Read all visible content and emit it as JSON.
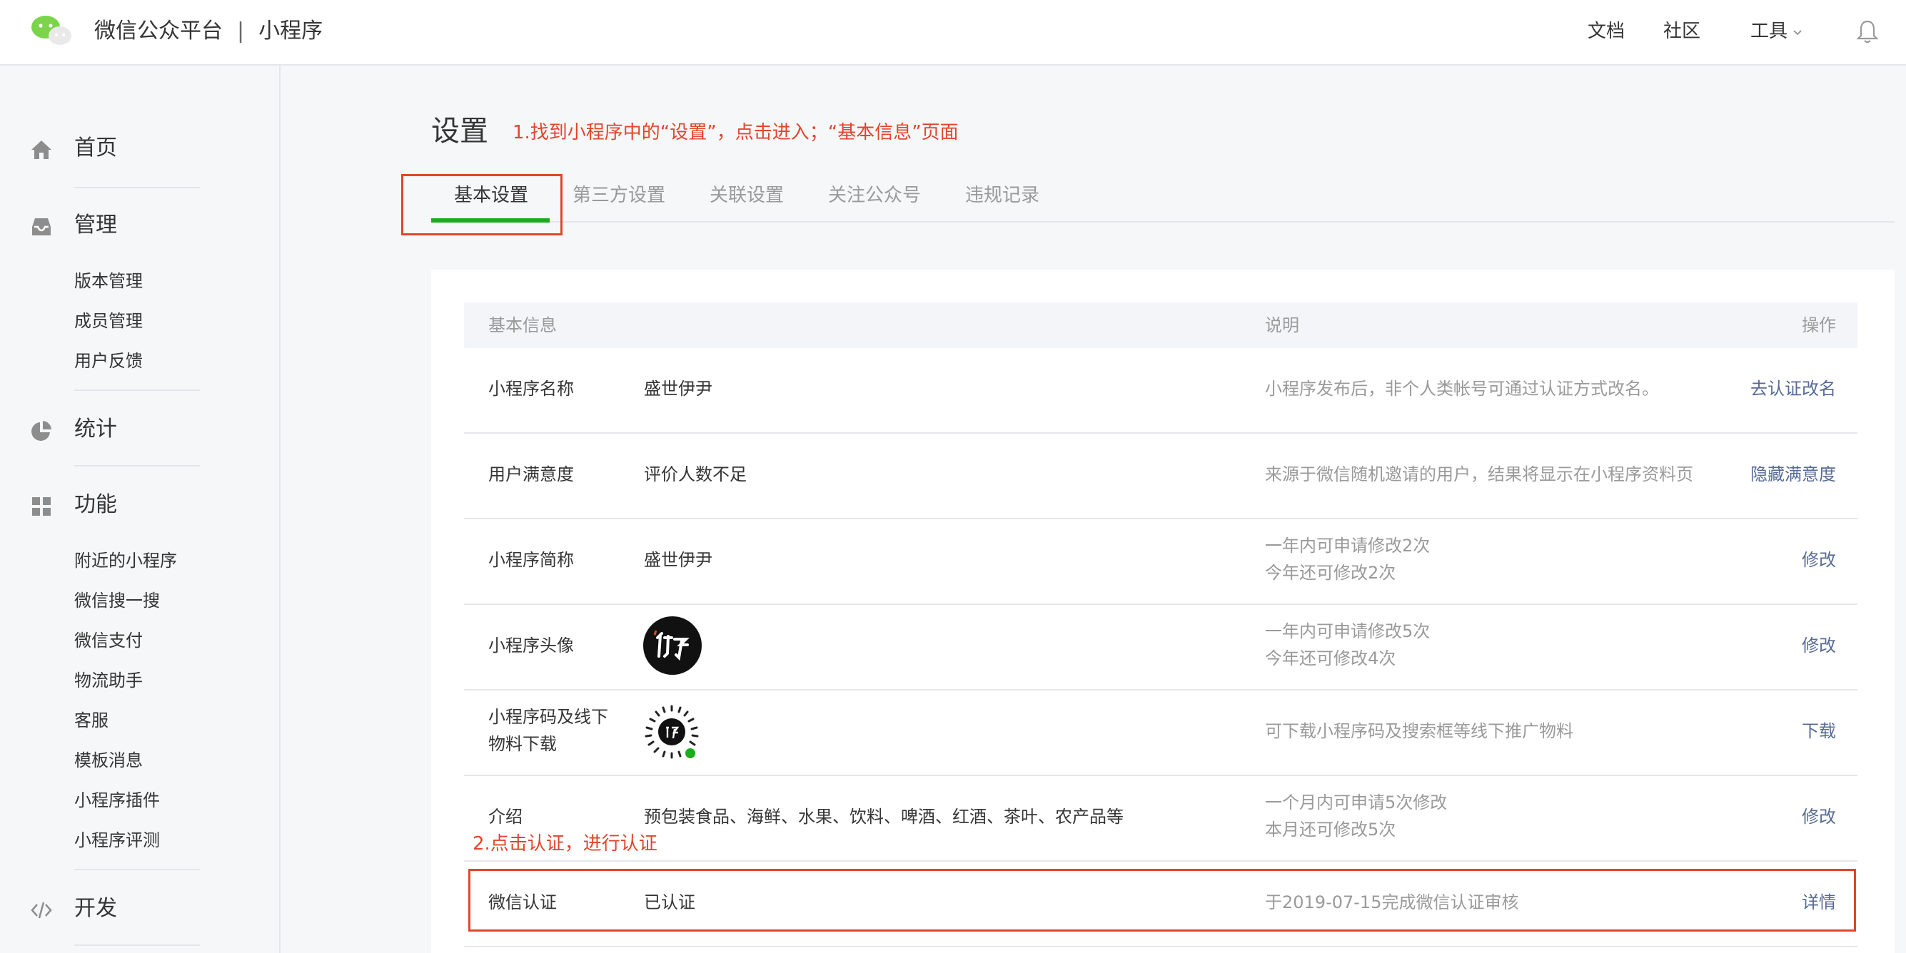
{
  "header": {
    "brand_name": "微信公众平台",
    "separator": "|",
    "product": "小程序",
    "links": {
      "docs": "文档",
      "community": "社区",
      "tools": "工具"
    }
  },
  "sidebar": {
    "groups": [
      {
        "label": "首页",
        "icon": "home-icon",
        "items": []
      },
      {
        "label": "管理",
        "icon": "inbox-icon",
        "items": [
          "版本管理",
          "成员管理",
          "用户反馈"
        ]
      },
      {
        "label": "统计",
        "icon": "pie-chart-icon",
        "items": []
      },
      {
        "label": "功能",
        "icon": "grid-icon",
        "items": [
          "附近的小程序",
          "微信搜一搜",
          "微信支付",
          "物流助手",
          "客服",
          "模板消息",
          "小程序插件",
          "小程序评测"
        ]
      },
      {
        "label": "开发",
        "icon": "code-icon",
        "items": []
      }
    ]
  },
  "main": {
    "title": "设置",
    "annotation_1": "1.找到小程序中的“设置”，点击进入；“基本信息”页面",
    "annotation_2": "2.点击认证，进行认证",
    "tabs": [
      {
        "label": "基本设置",
        "active": true
      },
      {
        "label": "第三方设置",
        "active": false
      },
      {
        "label": "关联设置",
        "active": false
      },
      {
        "label": "关注公众号",
        "active": false
      },
      {
        "label": "违规记录",
        "active": false
      }
    ],
    "table": {
      "headers": {
        "info": "基本信息",
        "desc": "说明",
        "action": "操作"
      },
      "rows": [
        {
          "label": "小程序名称",
          "value": "盛世伊尹",
          "desc_lines": [
            "小程序发布后，非个人类帐号可通过认证方式改名。"
          ],
          "action": "去认证改名"
        },
        {
          "label": "用户满意度",
          "value": "评价人数不足",
          "desc_lines": [
            "来源于微信随机邀请的用户，结果将显示在小程序资料页"
          ],
          "action": "隐藏满意度"
        },
        {
          "label": "小程序简称",
          "value": "盛世伊尹",
          "desc_lines": [
            "一年内可申请修改2次",
            "今年还可修改2次"
          ],
          "action": "修改"
        },
        {
          "label": "小程序头像",
          "value": "",
          "desc_lines": [
            "一年内可申请修改5次",
            "今年还可修改4次"
          ],
          "action": "修改"
        },
        {
          "label_lines": [
            "小程序码及线下",
            "物料下载"
          ],
          "value": "",
          "desc_lines": [
            "可下载小程序码及搜索框等线下推广物料"
          ],
          "action": "下载"
        },
        {
          "label": "介绍",
          "value": "预包装食品、海鲜、水果、饮料、啤酒、红酒、茶叶、农产品等",
          "desc_lines": [
            "一个月内可申请5次修改",
            "本月还可修改5次"
          ],
          "action": "修改"
        },
        {
          "label": "微信认证",
          "value": "已认证",
          "desc_lines": [
            "于2019-07-15完成微信认证审核"
          ],
          "action": "详情"
        }
      ]
    }
  },
  "colors": {
    "accent_green": "#1aad19",
    "annotation_red": "#e2452c",
    "link_blue": "#576b95"
  }
}
